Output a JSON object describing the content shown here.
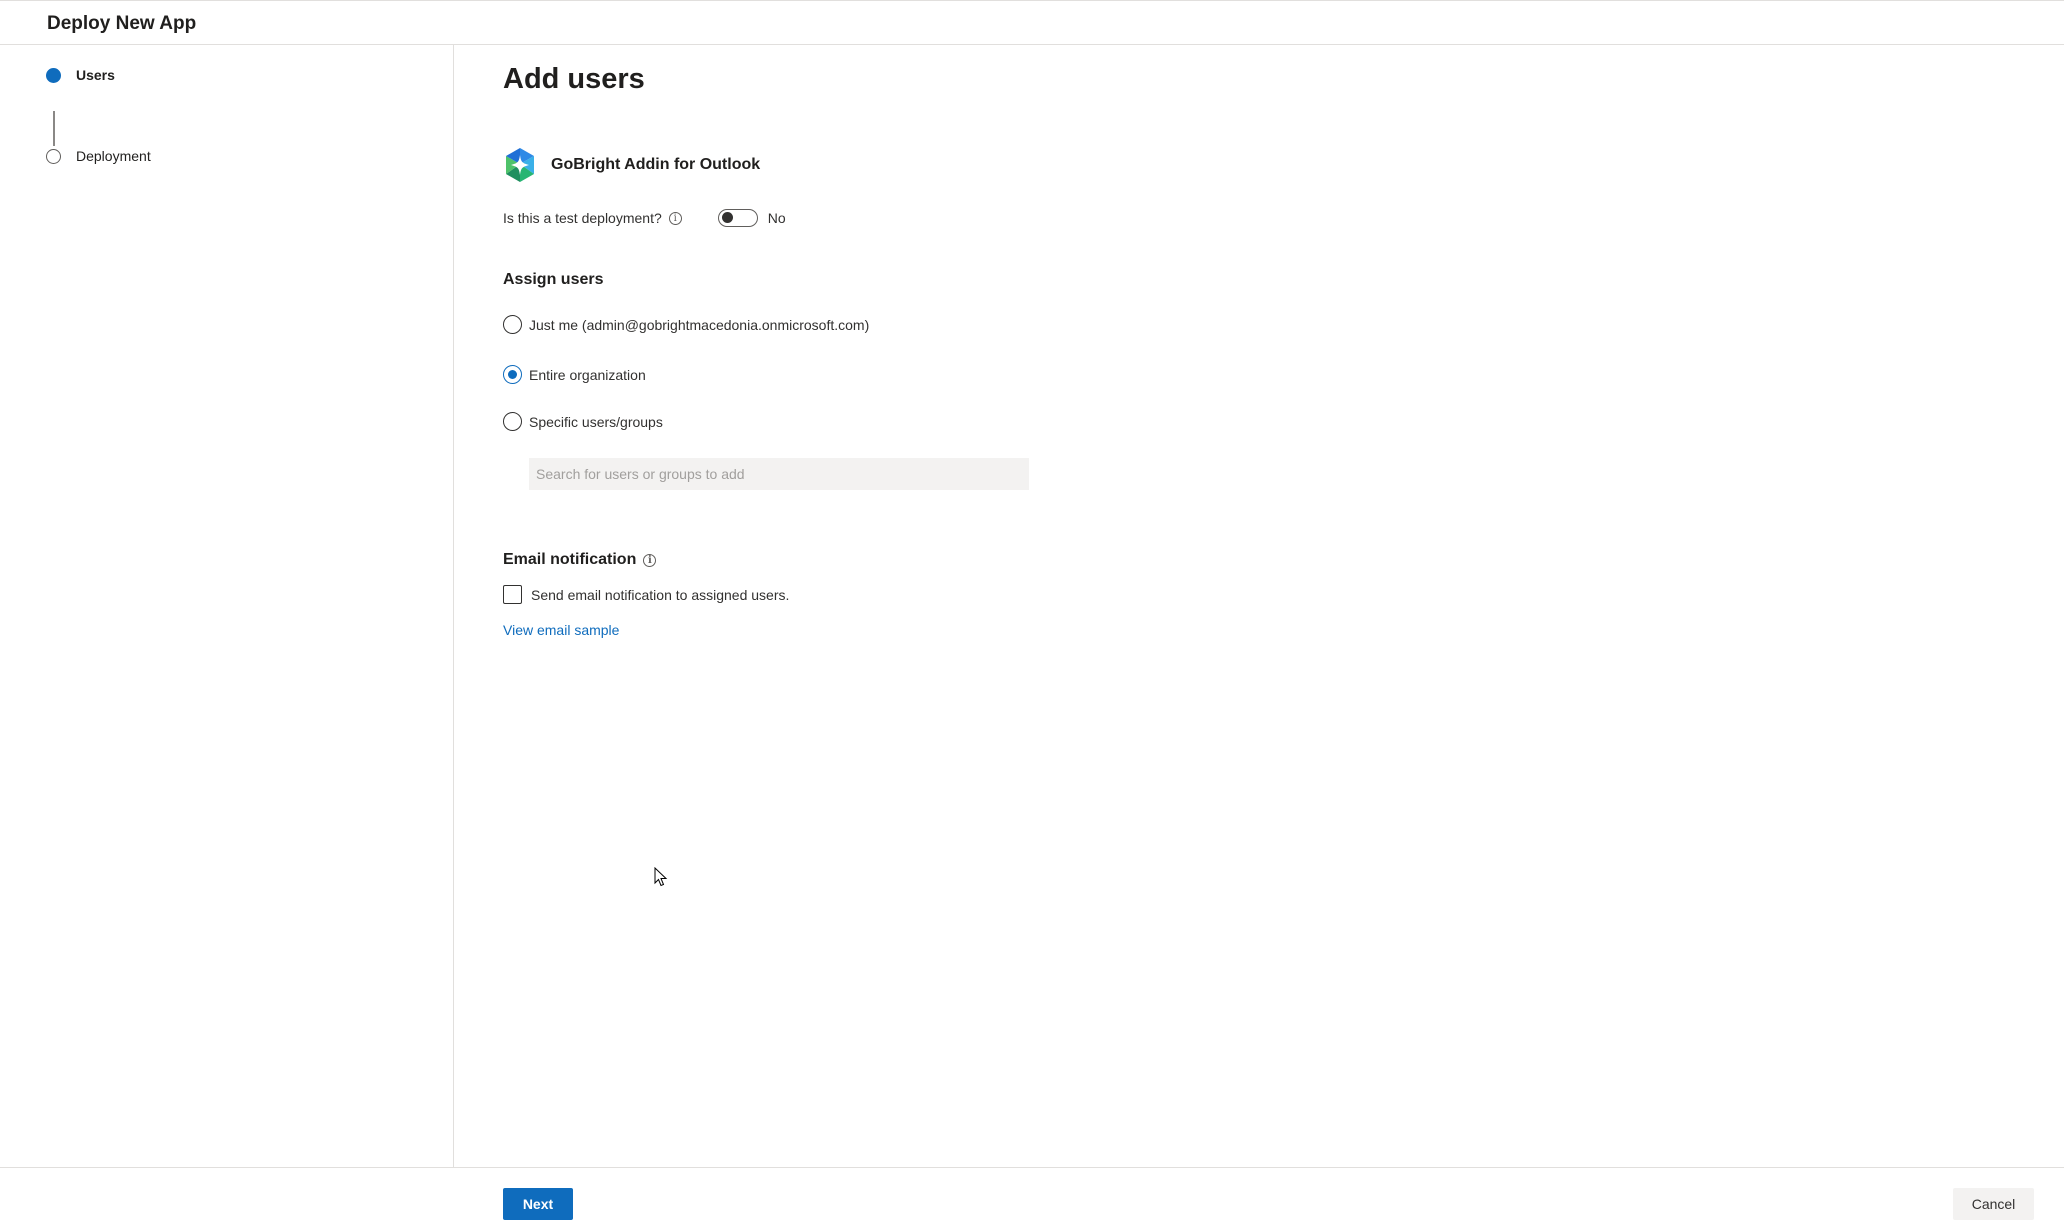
{
  "header": {
    "title": "Deploy New App"
  },
  "steps": [
    {
      "label": "Users",
      "state": "current"
    },
    {
      "label": "Deployment",
      "state": "upcoming"
    }
  ],
  "main": {
    "title": "Add users",
    "app": {
      "name": "GoBright Addin for Outlook",
      "icon": "gobright-logo-icon"
    },
    "test_deployment": {
      "question": "Is this a test deployment?",
      "value_label": "No",
      "on": false
    },
    "assign_users": {
      "title": "Assign users",
      "options": [
        {
          "label": "Just me (admin@gobrightmacedonia.onmicrosoft.com)",
          "checked": false
        },
        {
          "label": "Entire organization",
          "checked": true
        },
        {
          "label": "Specific users/groups",
          "checked": false
        }
      ],
      "search_placeholder": "Search for users or groups to add",
      "search_value": ""
    },
    "email_notification": {
      "title": "Email notification",
      "checkbox_label": "Send email notification to assigned users.",
      "checked": false,
      "link": "View email sample"
    }
  },
  "footer": {
    "next_label": "Next",
    "cancel_label": "Cancel"
  },
  "colors": {
    "accent": "#0f6cbd",
    "text": "#323130",
    "border": "#e1dfdd",
    "input_bg": "#f3f2f1"
  }
}
